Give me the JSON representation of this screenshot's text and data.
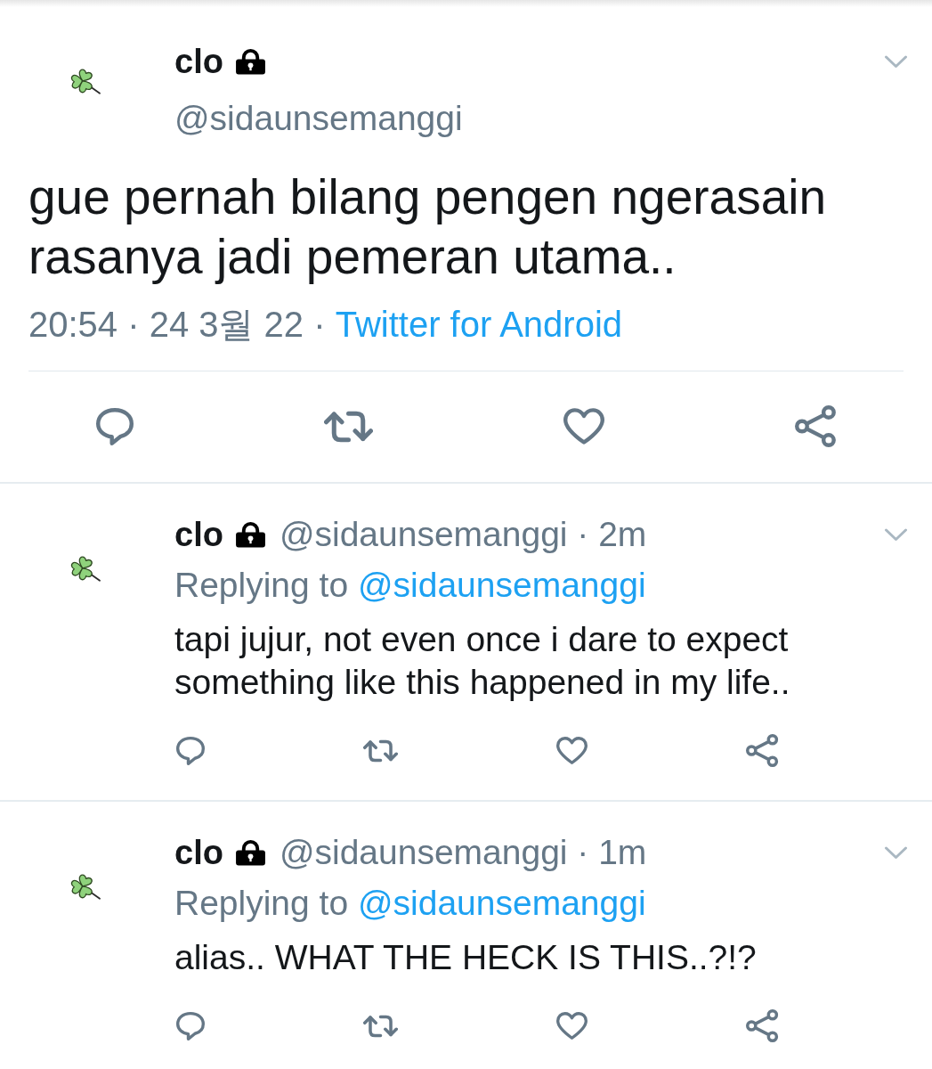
{
  "tweet": {
    "author": {
      "name": "clo",
      "protected": true,
      "handle": "@sidaunsemanggi"
    },
    "text": "gue pernah bilang pengen ngerasain rasanya jadi pemeran utama..",
    "timestamp": "20:54 · 24 3월 22 ·",
    "source": "Twitter for Android"
  },
  "replies": [
    {
      "name": "clo",
      "protected": true,
      "byline": "@sidaunsemanggi · 2m",
      "replying_label": "Replying to",
      "replying_to": "@sidaunsemanggi",
      "text": "tapi jujur, not even once i dare to expect something like this happened in my life.."
    },
    {
      "name": "clo",
      "protected": true,
      "byline": "@sidaunsemanggi · 1m",
      "replying_label": "Replying to",
      "replying_to": "@sidaunsemanggi",
      "text": "alias.. WHAT THE HECK IS THIS..?!?"
    }
  ]
}
